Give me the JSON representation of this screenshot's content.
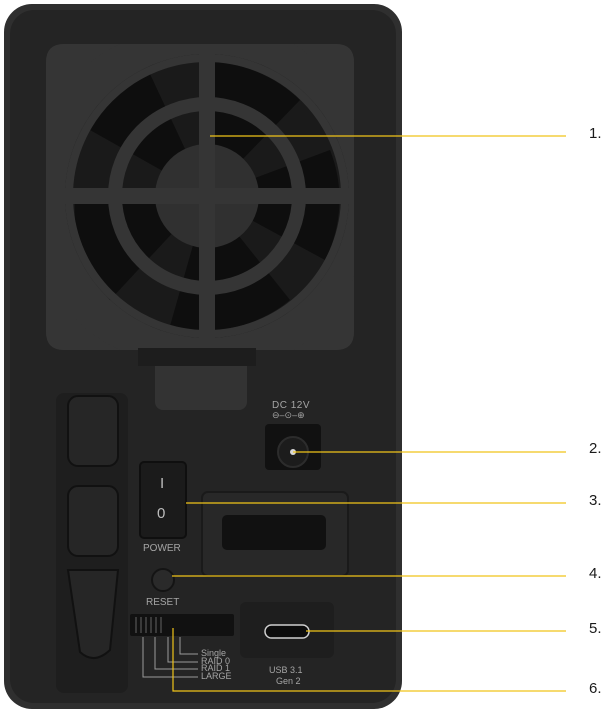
{
  "panel": {
    "dc_label": "DC 12V",
    "polarity_symbol": "⊖–⊙–⊕",
    "power_on_mark": "I",
    "power_off_mark": "0",
    "power_label": "POWER",
    "reset_label": "RESET",
    "usb_label_line1": "USB 3.1",
    "usb_label_line2": "Gen 2",
    "raid_modes": [
      "Single",
      "RAID 0",
      "RAID 1",
      "LARGE"
    ]
  },
  "callouts": [
    "1.",
    "2.",
    "3.",
    "4.",
    "5.",
    "6."
  ],
  "colors": {
    "enclosure": "#2b2b2b",
    "panel": "#232323",
    "fan_plate": "#303030",
    "grill": "#141414",
    "leader_line": "#f0c419",
    "label_text": "#9a9a9a"
  }
}
